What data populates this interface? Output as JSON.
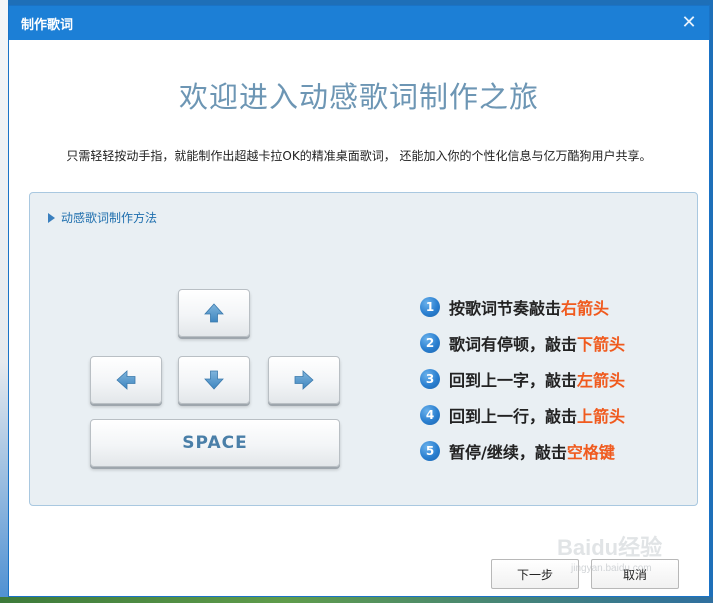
{
  "window": {
    "title": "制作歌词",
    "close_symbol": "✕"
  },
  "headline": "欢迎进入动感歌词制作之旅",
  "subline": "只需轻轻按动手指，就能制作出超越卡拉OK的精准桌面歌词， 还能加入你的个性化信息与亿万酷狗用户共享。",
  "panel": {
    "header": "动感歌词制作方法",
    "header_icon": "triangle-right-icon",
    "keys": {
      "up_icon": "arrow-up-icon",
      "left_icon": "arrow-left-icon",
      "down_icon": "arrow-down-icon",
      "right_icon": "arrow-right-icon",
      "space_label": "SPACE"
    },
    "steps": [
      {
        "num": "1",
        "text": "按歌词节奏敲击",
        "key": "右箭头"
      },
      {
        "num": "2",
        "text": "歌词有停顿，敲击",
        "key": "下箭头"
      },
      {
        "num": "3",
        "text": "回到上一字，敲击",
        "key": "左箭头"
      },
      {
        "num": "4",
        "text": "回到上一行，敲击",
        "key": "上箭头"
      },
      {
        "num": "5",
        "text": "暂停/继续，敲击",
        "key": "空格键"
      }
    ]
  },
  "buttons": {
    "next": "下一步",
    "cancel": "取消"
  },
  "watermark": {
    "text": "Baidu经验",
    "sub": "jingyan.baidu.com"
  },
  "colors": {
    "titlebar": "#1c7fd6",
    "headline": "#6d96b4",
    "key_highlight": "#f05a1e",
    "step_badge": "#2a7fd0"
  }
}
